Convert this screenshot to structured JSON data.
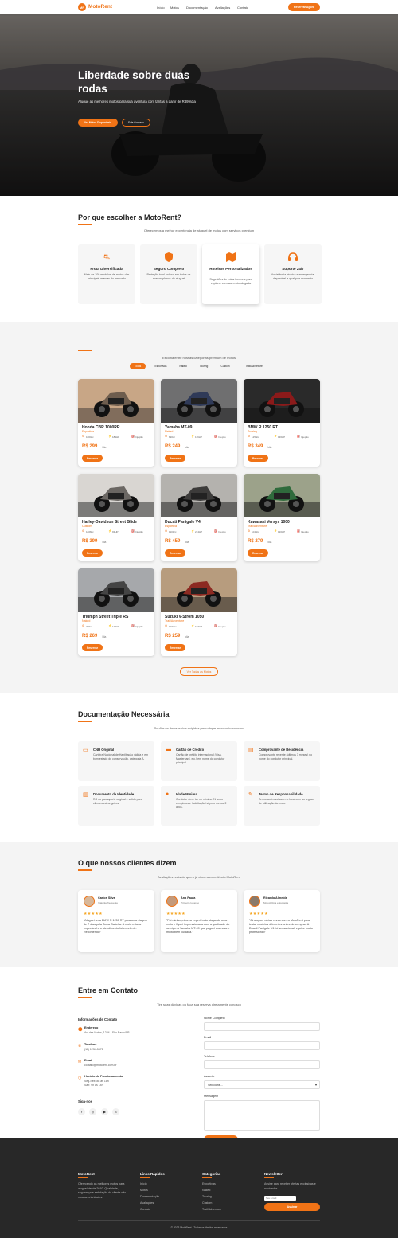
{
  "nav": {
    "logo_badge": "MR",
    "logo_text": "MotoRent",
    "links": [
      "Início",
      "Motos",
      "Documentação",
      "Avaliações",
      "Contato"
    ],
    "cta": "Reservar Agora"
  },
  "hero": {
    "title": "Liberdade sobre duas rodas",
    "subtitle": "Alugue as melhores motos para sua aventura com tarifas a partir de R$99/dia",
    "btn_primary": "Ver Motos Disponíveis",
    "btn_secondary": "Fale Conosco"
  },
  "why": {
    "title": "Por que escolher a MotoRent?",
    "subtitle": "Oferecemos a melhor experiência de aluguel de motos com serviços premium",
    "features": [
      {
        "icon": "motorcycle-icon",
        "title": "Frota Diversificada",
        "desc": "Mais de 100 modelos de motos das principais marcas do mercado"
      },
      {
        "icon": "shield-icon",
        "title": "Seguro Completo",
        "desc": "Proteção total inclusa em todos os nossos planos de aluguel"
      },
      {
        "icon": "map-icon",
        "title": "Roteiros Personalizados",
        "desc": "Sugestões de rotas incríveis para explorar com sua moto alugada"
      },
      {
        "icon": "headset-icon",
        "title": "Suporte 24/7",
        "desc": "Assistência técnica e emergencial disponível a qualquer momento"
      }
    ]
  },
  "fleet": {
    "subtitle": "Escolha entre nossas categorias premium de motos",
    "filters": [
      "Todas",
      "Esportivas",
      "Naked",
      "Touring",
      "Custom",
      "Trail/Adventure"
    ],
    "per_day": "/dia",
    "reserve": "Reservar",
    "bikes": [
      {
        "name": "Honda CBR 1000RR",
        "category": "Esportiva",
        "cc": "1000cc",
        "hp": "189HP",
        "fuel": "Injeção",
        "price": "R$ 299"
      },
      {
        "name": "Yamaha MT-09",
        "category": "Naked",
        "cc": "890cc",
        "hp": "119HP",
        "fuel": "Injeção",
        "price": "R$ 249"
      },
      {
        "name": "BMW R 1250 RT",
        "category": "Touring",
        "cc": "1254cc",
        "hp": "136HP",
        "fuel": "Injeção",
        "price": "R$ 349"
      },
      {
        "name": "Harley-Davidson Street Glide",
        "category": "Custom",
        "cc": "1868cc",
        "hp": "93HP",
        "fuel": "Injeção",
        "price": "R$ 399"
      },
      {
        "name": "Ducati Panigale V4",
        "category": "Esportiva",
        "cc": "1103cc",
        "hp": "214HP",
        "fuel": "Injeção",
        "price": "R$ 459"
      },
      {
        "name": "Kawasaki Versys 1000",
        "category": "Trail/Adventure",
        "cc": "1043cc",
        "hp": "120HP",
        "fuel": "Injeção",
        "price": "R$ 279"
      },
      {
        "name": "Triumph Street Triple RS",
        "category": "Naked",
        "cc": "765cc",
        "hp": "123HP",
        "fuel": "Injeção",
        "price": "R$ 269"
      },
      {
        "name": "Suzuki V-Strom 1050",
        "category": "Trail/Adventure",
        "cc": "1037cc",
        "hp": "107HP",
        "fuel": "Injeção",
        "price": "R$ 259"
      }
    ],
    "see_all": "Ver Todas as Motos"
  },
  "docs": {
    "title": "Documentação Necessária",
    "subtitle": "Confira os documentos exigidos para alugar uma moto conosco",
    "items": [
      {
        "icon": "id-card-icon",
        "title": "CNH Original",
        "desc": "Carteira Nacional de Habilitação válida e em bom estado de conservação, categoria A."
      },
      {
        "icon": "credit-card-icon",
        "title": "Cartão de Crédito",
        "desc": "Cartão de crédito internacional (Visa, Mastercard, etc.) em nome do condutor principal."
      },
      {
        "icon": "document-icon",
        "title": "Comprovante de Residência",
        "desc": "Comprovante recente (últimos 3 meses) no nome do condutor principal."
      },
      {
        "icon": "passport-icon",
        "title": "Documento de Identidade",
        "desc": "RG ou passaporte original e válido para clientes estrangeiros."
      },
      {
        "icon": "user-icon",
        "title": "Idade Mínima",
        "desc": "Condutor deve ter no mínimo 21 anos completos e habilitação há pelo menos 2 anos."
      },
      {
        "icon": "signature-icon",
        "title": "Termo de Responsabilidade",
        "desc": "Termo será assinado no local com as regras de utilização da moto."
      }
    ]
  },
  "testimonials": {
    "title": "O que nossos clientes dizem",
    "subtitle": "Avaliações reais de quem já viveu a experiência MotoRent",
    "items": [
      {
        "name": "Carlos Silva",
        "role": "Viajante frequente",
        "stars": "★★★★★",
        "text": "\"Aluguei uma BMW R 1250 RT para uma viagem de 7 dias pela Serra Gaúcha. A moto estava impecável e o atendimento foi excelente. Recomendo!\""
      },
      {
        "name": "Ana Paula",
        "role": "Primeira locação",
        "stars": "★★★★★",
        "text": "\"Foi minha primeira experiência alugando uma moto e fiquei impressionada com a qualidade do serviço. A Yamaha MT-09 que peguei era nova e muito bem cuidada.\""
      },
      {
        "name": "Ricardo Almeida",
        "role": "Motociclista entusiasta",
        "stars": "★★★★★",
        "text": "\"Já aluguei várias vezes com a MotoRent para testar modelos diferentes antes de comprar. A Ducati Panigale V4 foi sensacional, equipe muito profissional!\""
      }
    ]
  },
  "contact": {
    "title": "Entre em Contato",
    "subtitle": "Tire suas dúvidas ou faça sua reserva diretamente conosco",
    "info_title": "Informações de Contato",
    "address_label": "Endereço",
    "address": "Av. das Motos, 1234 - São Paulo/SP",
    "phone_label": "Telefone",
    "phone": "(11) 1234-5678",
    "email_label": "Email",
    "email": "contato@motorent.com.br",
    "hours_label": "Horário de Funcionamento",
    "hours1": "Seg-Sex: 8h às 18h",
    "hours2": "Sáb: 9h às 14h",
    "follow": "Siga-nos",
    "form": {
      "name": "Nome Completo",
      "email": "Email",
      "phone": "Telefone",
      "subject": "Assunto",
      "subject_value": "Selecione...",
      "message": "Mensagem",
      "submit": "Enviar Mensagem"
    }
  },
  "footer": {
    "brand": "MotoRent",
    "about": "Oferecendo as melhores motos para aluguel desde 2010. Qualidade, segurança e satisfação do cliente são nossas prioridades.",
    "links_title": "Links Rápidos",
    "links": [
      "Início",
      "Motos",
      "Documentação",
      "Avaliações",
      "Contato"
    ],
    "cats_title": "Categorias",
    "cats": [
      "Esportivas",
      "Naked",
      "Touring",
      "Custom",
      "Trail/Adventure"
    ],
    "news_title": "Newsletter",
    "news_text": "Assine para receber ofertas exclusivas e novidades.",
    "news_placeholder": "Seu email",
    "news_btn": "Assinar",
    "copyright": "© 2023 MotoRent - Todos os direitos reservados"
  },
  "colors": {
    "accent": "#f07316",
    "footer_bg": "#282828"
  }
}
